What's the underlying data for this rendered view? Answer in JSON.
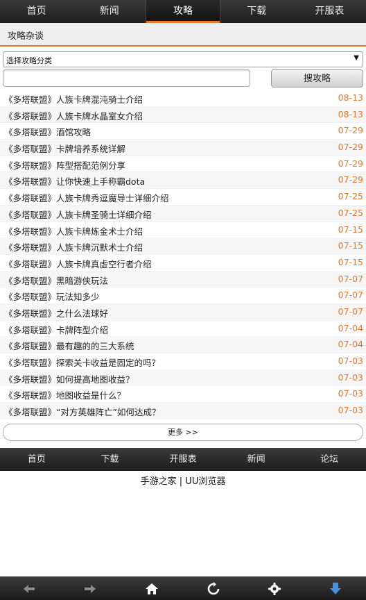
{
  "topnav": {
    "items": [
      {
        "label": "首页"
      },
      {
        "label": "新闻"
      },
      {
        "label": "攻略"
      },
      {
        "label": "下载"
      },
      {
        "label": "开服表"
      }
    ],
    "active": "攻略"
  },
  "section": {
    "title": "攻略杂谈"
  },
  "category_select": {
    "selected": "选择攻略分类"
  },
  "search": {
    "value": "",
    "button_label": "搜攻略"
  },
  "articles": [
    {
      "title": "《多塔联盟》人族卡牌混沌骑士介绍",
      "date": "08-13"
    },
    {
      "title": "《多塔联盟》人族卡牌水晶室女介绍",
      "date": "08-13"
    },
    {
      "title": "《多塔联盟》酒馆攻略",
      "date": "07-29"
    },
    {
      "title": "《多塔联盟》卡牌培养系统详解",
      "date": "07-29"
    },
    {
      "title": "《多塔联盟》阵型搭配范例分享",
      "date": "07-29"
    },
    {
      "title": "《多塔联盟》让你快速上手称霸dota",
      "date": "07-29"
    },
    {
      "title": "《多塔联盟》人族卡牌秀逗魔导士详细介绍",
      "date": "07-25"
    },
    {
      "title": "《多塔联盟》人族卡牌圣骑士详细介绍",
      "date": "07-25"
    },
    {
      "title": "《多塔联盟》人族卡牌炼金术士介绍",
      "date": "07-15"
    },
    {
      "title": "《多塔联盟》人族卡牌沉默术士介绍",
      "date": "07-15"
    },
    {
      "title": "《多塔联盟》人族卡牌真虚空行者介绍",
      "date": "07-15"
    },
    {
      "title": "《多塔联盟》黑暗游侠玩法",
      "date": "07-07"
    },
    {
      "title": "《多塔联盟》玩法知多少",
      "date": "07-07"
    },
    {
      "title": "《多塔联盟》之什么法球好",
      "date": "07-07"
    },
    {
      "title": "《多塔联盟》卡牌阵型介绍",
      "date": "07-04"
    },
    {
      "title": "《多塔联盟》最有趣的的三大系统",
      "date": "07-04"
    },
    {
      "title": "《多塔联盟》探索关卡收益是固定的吗？",
      "date": "07-03"
    },
    {
      "title": "《多塔联盟》如何提高地图收益？",
      "date": "07-03"
    },
    {
      "title": "《多塔联盟》地图收益是什么？",
      "date": "07-03"
    },
    {
      "title": "《多塔联盟》“对方英雄阵亡”如何达成？",
      "date": "07-03"
    }
  ],
  "more": {
    "label": "更多 >>"
  },
  "bottomnav": {
    "items": [
      {
        "label": "首页"
      },
      {
        "label": "下载"
      },
      {
        "label": "开服表"
      },
      {
        "label": "新闻"
      },
      {
        "label": "论坛"
      }
    ]
  },
  "footer": {
    "text": "手游之家 | UU浏览器"
  },
  "toolbar": {
    "icons": [
      "back-arrow-icon",
      "forward-arrow-icon",
      "home-icon",
      "refresh-icon",
      "settings-icon",
      "download-icon"
    ]
  },
  "colors": {
    "accent": "#e8762b",
    "nav_bg": "#2a2a2a",
    "download": "#4a90d9"
  }
}
